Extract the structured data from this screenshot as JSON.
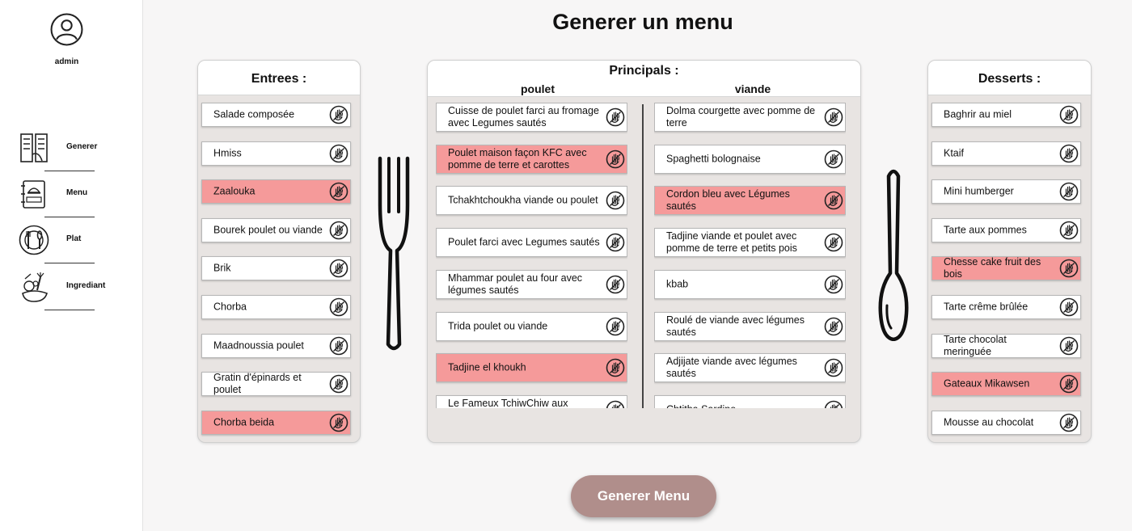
{
  "sidebar": {
    "username": "admin",
    "nav": [
      {
        "label": "Generer",
        "icon": "menu-list-icon"
      },
      {
        "label": "Menu",
        "icon": "menu-book-icon"
      },
      {
        "label": "Plat",
        "icon": "plate-cutlery-icon"
      },
      {
        "label": "Ingrediant",
        "icon": "vegetables-icon"
      }
    ]
  },
  "page": {
    "title": "Generer un menu"
  },
  "entrees": {
    "title": "Entrees :",
    "items": [
      {
        "label": "Salade composée",
        "selected": false
      },
      {
        "label": "Hmiss",
        "selected": false
      },
      {
        "label": "Zaalouka",
        "selected": true
      },
      {
        "label": "Bourek poulet ou viande",
        "selected": false
      },
      {
        "label": "Brik",
        "selected": false
      },
      {
        "label": "Chorba",
        "selected": false
      },
      {
        "label": "Maadnoussia poulet",
        "selected": false
      },
      {
        "label": "Gratin d'épinards et poulet",
        "selected": false
      },
      {
        "label": "Chorba beida",
        "selected": true
      }
    ]
  },
  "principals": {
    "title": "Principals :",
    "poulet": {
      "title": "poulet",
      "items": [
        {
          "label": "Cuisse de poulet farci au fromage avec Legumes sautés",
          "selected": false
        },
        {
          "label": "Poulet maison façon KFC avec pomme de terre et carottes",
          "selected": true
        },
        {
          "label": "Tchakhtchoukha viande ou poulet",
          "selected": false
        },
        {
          "label": "Poulet farci avec Legumes sautés",
          "selected": false
        },
        {
          "label": "Mhammar poulet au four avec légumes sautés",
          "selected": false
        },
        {
          "label": "Trida poulet ou viande",
          "selected": false
        },
        {
          "label": "Tadjine el khoukh",
          "selected": true
        },
        {
          "label": "Le Fameux TchiwChiw aux Legumes avec du petit lait",
          "selected": false
        }
      ]
    },
    "viande": {
      "title": "viande",
      "items": [
        {
          "label": "Dolma courgette avec pomme de terre",
          "selected": false
        },
        {
          "label": "Spaghetti bolognaise",
          "selected": false
        },
        {
          "label": "Cordon bleu avec Légumes sautés",
          "selected": true
        },
        {
          "label": "Tadjine viande et poulet avec pomme de terre et petits pois",
          "selected": false
        },
        {
          "label": "kbab",
          "selected": false
        },
        {
          "label": "Roulé de viande avec légumes sautés",
          "selected": false
        },
        {
          "label": "Adjijate viande avec légumes sautés",
          "selected": false
        },
        {
          "label": "Chtitha Sardine",
          "selected": false
        }
      ]
    }
  },
  "desserts": {
    "title": "Desserts :",
    "items": [
      {
        "label": "Baghrir au miel",
        "selected": false
      },
      {
        "label": "Ktaif",
        "selected": false
      },
      {
        "label": "Mini humberger",
        "selected": false
      },
      {
        "label": "Tarte aux pommes",
        "selected": false
      },
      {
        "label": "Chesse cake fruit des bois",
        "selected": true
      },
      {
        "label": "Tarte crême brûlée",
        "selected": false
      },
      {
        "label": "Tarte chocolat meringuée",
        "selected": false
      },
      {
        "label": "Gateaux Mikawsen",
        "selected": true
      },
      {
        "label": "Mousse au chocolat",
        "selected": false
      }
    ]
  },
  "actions": {
    "generate_label": "Generer Menu"
  },
  "colors": {
    "selected": "#f59a9a",
    "button": "#b08e8b",
    "panel": "#e8e4e2"
  }
}
